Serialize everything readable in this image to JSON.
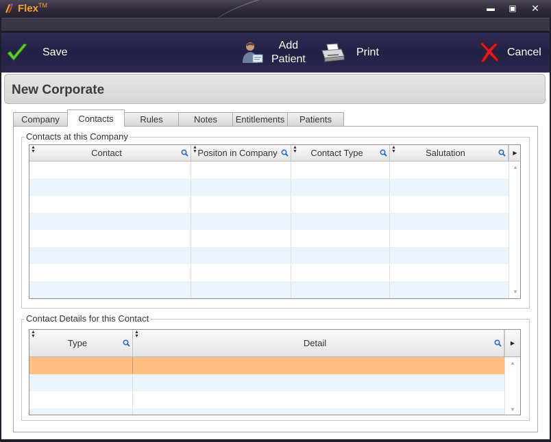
{
  "app": {
    "title": "Flex",
    "trademark": "TM",
    "window_controls": {
      "minimize": "▬",
      "maximize": "▣",
      "close": "✕"
    }
  },
  "toolbar": {
    "save_label": "Save",
    "add_patient_label_1": "Add",
    "add_patient_label_2": "Patient",
    "print_label": "Print",
    "cancel_label": "Cancel",
    "icons": {
      "save": "checkmark-icon",
      "add_patient": "patient-icon",
      "print": "printer-icon",
      "cancel": "x-icon"
    }
  },
  "page": {
    "title": "New Corporate"
  },
  "tabs": [
    {
      "label": "Company"
    },
    {
      "label": "Contacts",
      "active": true
    },
    {
      "label": "Rules"
    },
    {
      "label": "Notes"
    },
    {
      "label": "Entitlements"
    },
    {
      "label": "Patients"
    }
  ],
  "contacts_group": {
    "label": "Contacts at this Company",
    "columns": [
      "Contact",
      "Positon in Company",
      "Contact Type",
      "Salutation"
    ],
    "rows": []
  },
  "details_group": {
    "label": "Contact Details for this Contact",
    "columns": [
      "Type",
      "Detail"
    ],
    "rows": [],
    "selected_row_color": "#ffbf80"
  },
  "colors": {
    "accent_title": "#f5a526",
    "row_alt": "#edf3fb",
    "toolbar": "#25234a"
  }
}
